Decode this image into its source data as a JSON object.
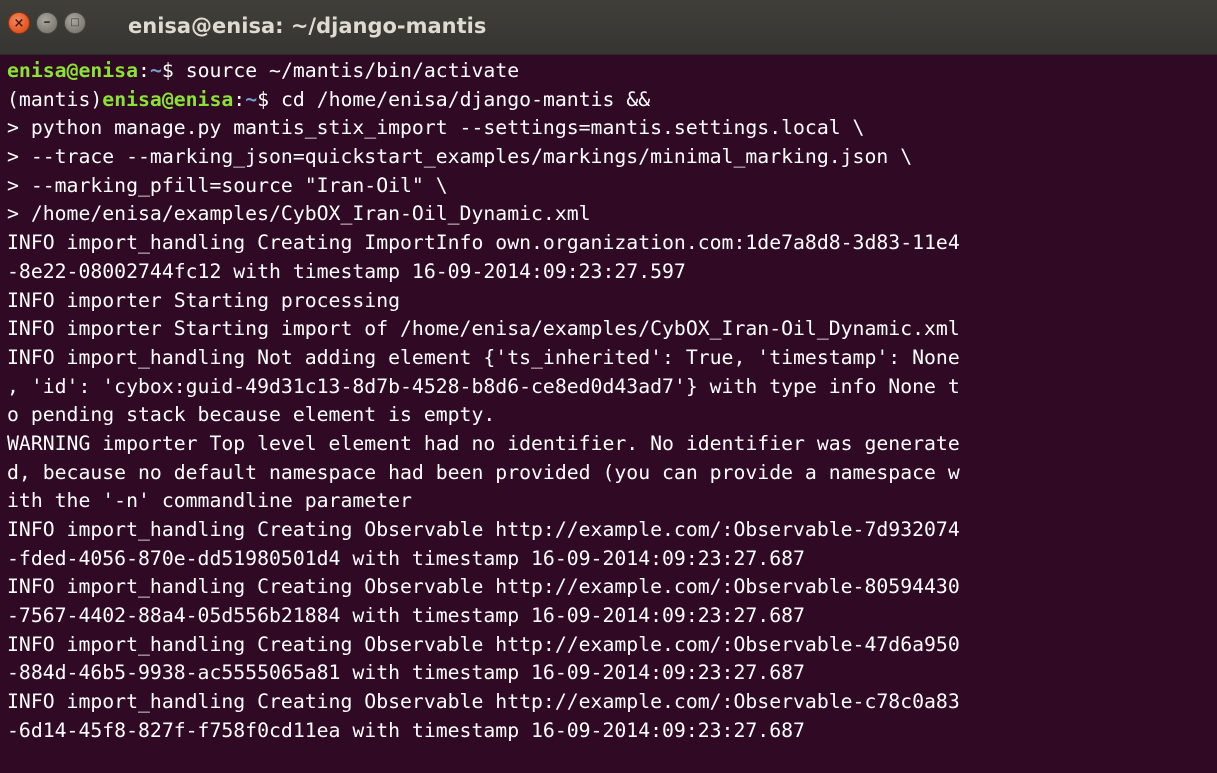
{
  "window": {
    "title": "enisa@enisa: ~/django-mantis",
    "close_glyph": "×",
    "minimize_glyph": "–",
    "maximize_glyph": "□"
  },
  "colors": {
    "terminal_background": "#300a24",
    "terminal_text": "#ffffff",
    "prompt_user": "#8ae234",
    "prompt_path": "#729fcf",
    "titlebar": "#3c3b37",
    "close_button": "#e95420"
  },
  "terminal": {
    "prompt1": {
      "user": "enisa@enisa",
      "sep": ":",
      "path": "~",
      "symbol": "$ ",
      "command": "source ~/mantis/bin/activate"
    },
    "prompt2": {
      "env": "(mantis)",
      "user": "enisa@enisa",
      "sep": ":",
      "path": "~",
      "symbol": "$ ",
      "command": "cd /home/enisa/django-mantis &&"
    },
    "lines": [
      "> python manage.py mantis_stix_import --settings=mantis.settings.local \\",
      "> --trace --marking_json=quickstart_examples/markings/minimal_marking.json \\",
      "> --marking_pfill=source \"Iran-Oil\" \\",
      "> /home/enisa/examples/CybOX_Iran-Oil_Dynamic.xml",
      "INFO import_handling Creating ImportInfo own.organization.com:1de7a8d8-3d83-11e4",
      "-8e22-08002744fc12 with timestamp 16-09-2014:09:23:27.597",
      "INFO importer Starting processing",
      "INFO importer Starting import of /home/enisa/examples/CybOX_Iran-Oil_Dynamic.xml",
      "INFO import_handling Not adding element {'ts_inherited': True, 'timestamp': None",
      ", 'id': 'cybox:guid-49d31c13-8d7b-4528-b8d6-ce8ed0d43ad7'} with type info None t",
      "o pending stack because element is empty.",
      "WARNING importer Top level element had no identifier. No identifier was generate",
      "d, because no default namespace had been provided (you can provide a namespace w",
      "ith the '-n' commandline parameter",
      "INFO import_handling Creating Observable http://example.com/:Observable-7d932074",
      "-fded-4056-870e-dd51980501d4 with timestamp 16-09-2014:09:23:27.687",
      "INFO import_handling Creating Observable http://example.com/:Observable-80594430",
      "-7567-4402-88a4-05d556b21884 with timestamp 16-09-2014:09:23:27.687",
      "INFO import_handling Creating Observable http://example.com/:Observable-47d6a950",
      "-884d-46b5-9938-ac5555065a81 with timestamp 16-09-2014:09:23:27.687",
      "INFO import_handling Creating Observable http://example.com/:Observable-c78c0a83",
      "-6d14-45f8-827f-f758f0cd11ea with timestamp 16-09-2014:09:23:27.687"
    ]
  }
}
